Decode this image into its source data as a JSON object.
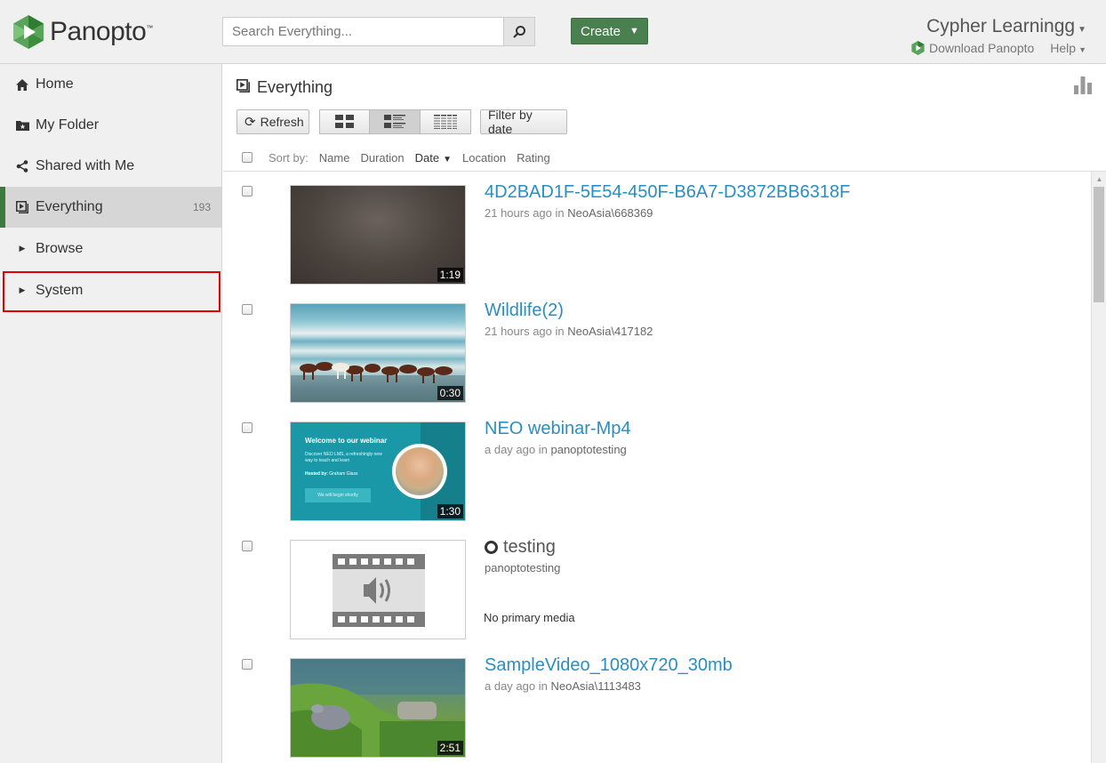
{
  "header": {
    "logo_text": "Panopto",
    "logo_tm": "™",
    "search_placeholder": "Search Everything...",
    "create_label": "Create",
    "user_name": "Cypher Learningg",
    "download_label": "Download Panopto",
    "help_label": "Help"
  },
  "sidebar": {
    "items": [
      {
        "label": "Home"
      },
      {
        "label": "My Folder"
      },
      {
        "label": "Shared with Me"
      },
      {
        "label": "Everything",
        "count": "193"
      },
      {
        "label": "Browse"
      },
      {
        "label": "System"
      }
    ]
  },
  "main": {
    "title": "Everything",
    "toolbar": {
      "refresh_label": "Refresh",
      "filter_label": "Filter by date"
    },
    "sort": {
      "label": "Sort by:",
      "options": [
        "Name",
        "Duration",
        "Date",
        "Location",
        "Rating"
      ],
      "selected": "Date"
    },
    "sessions": [
      {
        "title": "4D2BAD1F-5E54-450F-B6A7-D3872BB6318F",
        "time": "21 hours ago",
        "in": "in",
        "location": "NeoAsia\\668369",
        "duration": "1:19"
      },
      {
        "title": "Wildlife(2)",
        "time": "21 hours ago",
        "in": "in",
        "location": "NeoAsia\\417182",
        "duration": "0:30"
      },
      {
        "title": "NEO webinar-Mp4",
        "time": "a day ago",
        "in": "in",
        "location": "panoptotesting",
        "duration": "1:30",
        "thumb_text": {
          "heading": "Welcome to our webinar",
          "body": "Discover NEO LMS, a refreshingly new way to teach and learn",
          "host_label": "Hosted by:",
          "host": "Graham Glass",
          "button": "We will begin shortly"
        }
      },
      {
        "title": "testing",
        "location": "panoptotesting",
        "note": "No primary media"
      },
      {
        "title": "SampleVideo_1080x720_30mb",
        "time": "a day ago",
        "in": "in",
        "location": "NeoAsia\\1113483",
        "duration": "2:51"
      }
    ]
  },
  "colors": {
    "accent_green": "#4a7f4f",
    "link_blue": "#2a8ec0",
    "highlight_red": "#e00000"
  }
}
